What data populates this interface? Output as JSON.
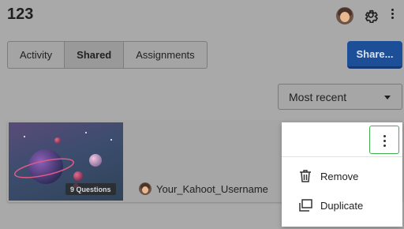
{
  "header": {
    "title": "123",
    "icons": [
      "avatar",
      "gear-icon",
      "more-vertical-icon"
    ]
  },
  "tabs": [
    {
      "label": "Activity",
      "active": false
    },
    {
      "label": "Shared",
      "active": true
    },
    {
      "label": "Assignments",
      "active": false
    }
  ],
  "share_button": {
    "label": "Share...",
    "color": "#1d4f99"
  },
  "sort": {
    "selected": "Most recent"
  },
  "card": {
    "question_count": "9 Questions",
    "owner": "Your_Kahoot_Username"
  },
  "context_menu": {
    "items": [
      {
        "label": "Remove",
        "icon": "trash-icon"
      },
      {
        "label": "Duplicate",
        "icon": "duplicate-icon"
      }
    ],
    "active_border_color": "#3fae4c"
  }
}
